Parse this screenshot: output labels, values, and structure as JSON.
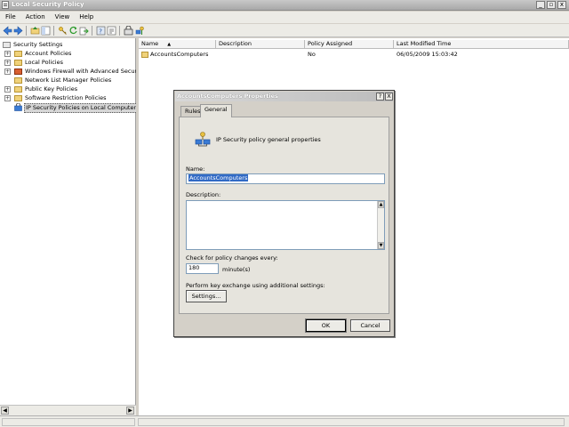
{
  "window": {
    "title": "Local Security Policy"
  },
  "menu": [
    "File",
    "Action",
    "View",
    "Help"
  ],
  "toolbar": {
    "icons": [
      "back-icon",
      "forward-icon",
      "up-folder-icon",
      "show-hide-tree-icon",
      "key-icon",
      "refresh-icon",
      "export-icon",
      "help-icon",
      "properties-icon",
      "ip-policy-icon"
    ]
  },
  "tree": {
    "items": [
      {
        "label": "Security Settings",
        "expander": "-"
      },
      {
        "label": "Account Policies",
        "expander": "+"
      },
      {
        "label": "Local Policies",
        "expander": "+"
      },
      {
        "label": "Windows Firewall with Advanced Security",
        "expander": "+"
      },
      {
        "label": "Network List Manager Policies",
        "expander": ""
      },
      {
        "label": "Public Key Policies",
        "expander": "+"
      },
      {
        "label": "Software Restriction Policies",
        "expander": "+"
      },
      {
        "label": "IP Security Policies on Local Computer",
        "expander": ""
      }
    ]
  },
  "list": {
    "columns": [
      "Name",
      "Description",
      "Policy Assigned",
      "Last Modified Time"
    ],
    "sort_indicator": "▲",
    "rows": [
      {
        "name": "AccountsComputers",
        "description": "",
        "assigned": "No",
        "modified": "06/05/2009 15:03:42"
      }
    ]
  },
  "dialog": {
    "title": "AccountsComputers Properties",
    "help_btn": "?",
    "close_btn": "X",
    "tabs": [
      "Rules",
      "General"
    ],
    "active_tab": "General",
    "header_text": "IP Security policy general properties",
    "name_label": "Name:",
    "name_value": "AccountsComputers",
    "description_label": "Description:",
    "description_value": "",
    "check_label": "Check for policy changes every:",
    "interval_value": "180",
    "interval_unit": "minute(s)",
    "key_exchange_label": "Perform key exchange using additional settings:",
    "settings_btn": "Settings...",
    "ok_btn": "OK",
    "cancel_btn": "Cancel"
  },
  "colors": {
    "selection": "#316ac5",
    "folder": "#f0d27a"
  }
}
